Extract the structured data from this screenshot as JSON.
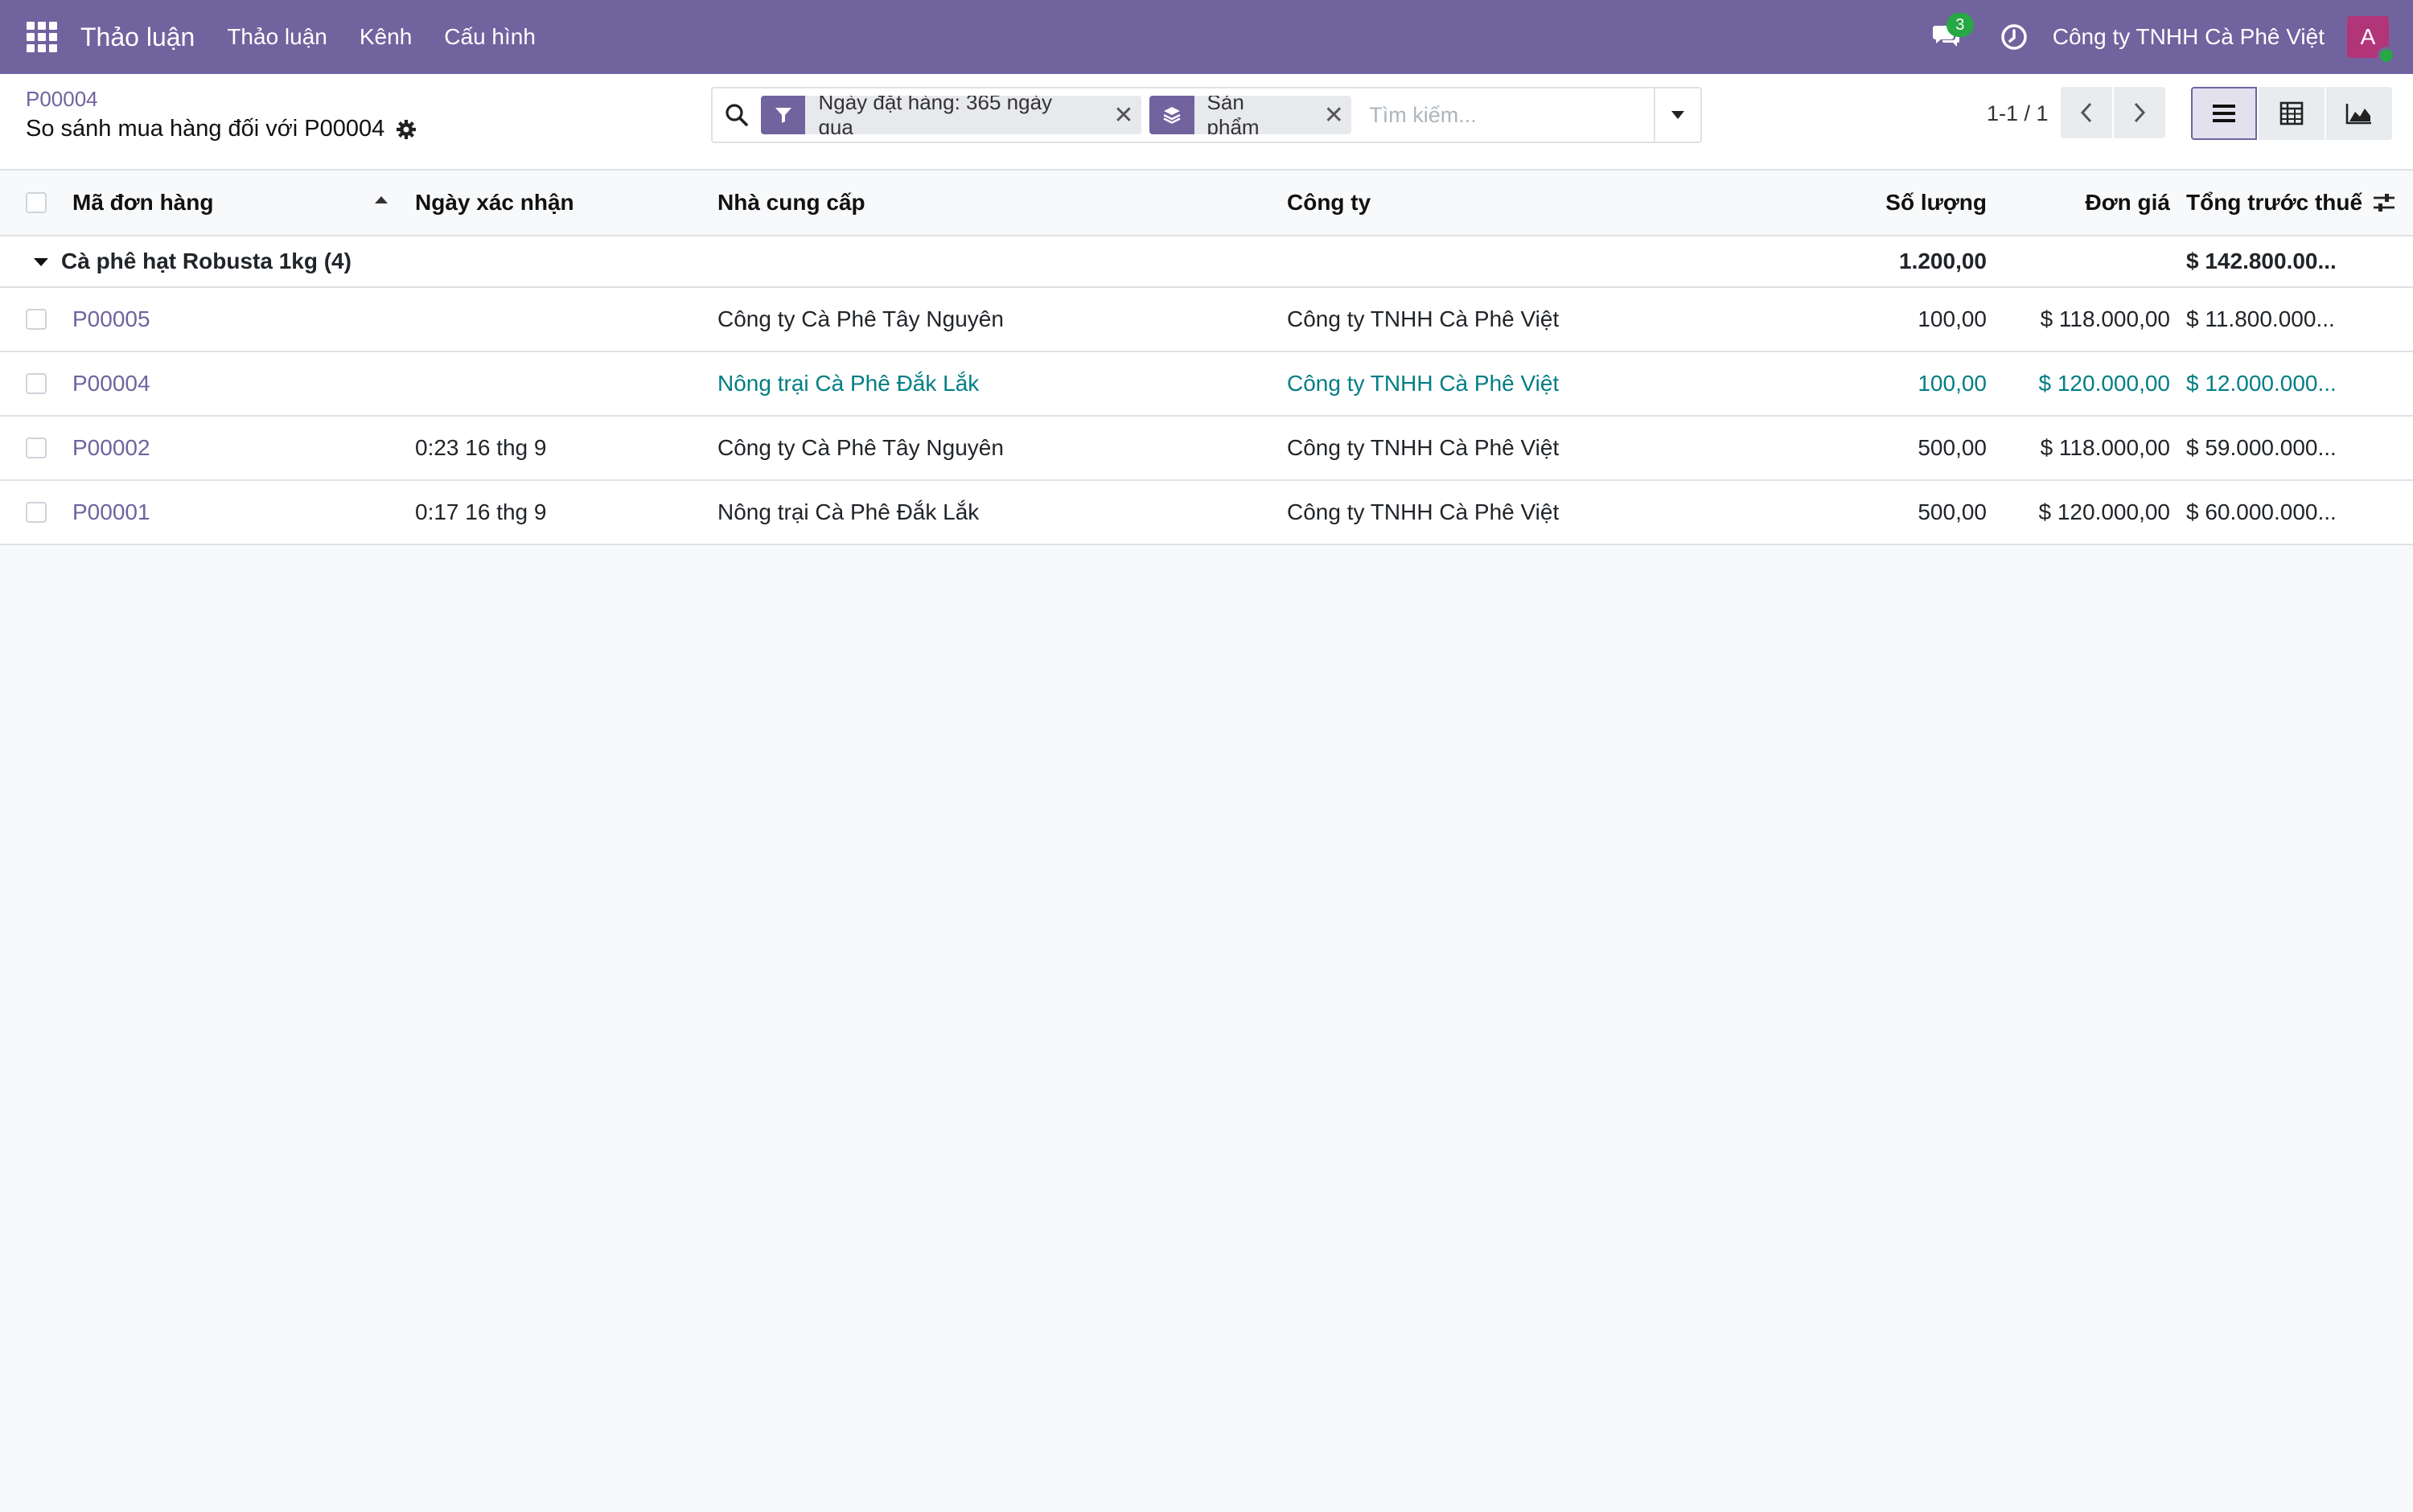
{
  "navbar": {
    "brand": "Thảo luận",
    "menu": [
      "Thảo luận",
      "Kênh",
      "Cấu hình"
    ],
    "chat_count": "3",
    "company": "Công ty TNHH Cà Phê Việt",
    "avatar_initial": "A",
    "bg_color": "#71639e"
  },
  "control": {
    "breadcrumb": "P00004",
    "title": "So sánh mua hàng đối với P00004",
    "facets": [
      {
        "icon": "filter-icon",
        "label": "Ngày đặt hàng: 365 ngày qua"
      },
      {
        "icon": "group-by-icon",
        "label": "Sản phẩm"
      }
    ],
    "search_placeholder": "Tìm kiếm...",
    "pager": "1-1 / 1"
  },
  "table": {
    "columns": [
      "Mã đơn hàng",
      "Ngày xác nhận",
      "Nhà cung cấp",
      "Công ty",
      "Số lượng",
      "Đơn giá",
      "Tổng trước thuế"
    ],
    "group": {
      "label": "Cà phê hạt Robusta 1kg (4)",
      "qty": "1.200,00",
      "total": "$ 142.800.00..."
    },
    "rows": [
      {
        "order": "P00005",
        "date": "",
        "vendor": "Công ty Cà Phê Tây Nguyên",
        "company": "Công ty TNHH Cà Phê Việt",
        "qty": "100,00",
        "price": "$ 118.000,00",
        "total": "$ 11.800.000..."
      },
      {
        "order": "P00004",
        "date": "",
        "vendor": "Nông trại Cà Phê Đắk Lắk",
        "company": "Công ty TNHH Cà Phê Việt",
        "qty": "100,00",
        "price": "$ 120.000,00",
        "total": "$ 12.000.000..."
      },
      {
        "order": "P00002",
        "date": "0:23 16 thg 9",
        "vendor": "Công ty Cà Phê Tây Nguyên",
        "company": "Công ty TNHH Cà Phê Việt",
        "qty": "500,00",
        "price": "$ 118.000,00",
        "total": "$ 59.000.000..."
      },
      {
        "order": "P00001",
        "date": "0:17 16 thg 9",
        "vendor": "Nông trại Cà Phê Đắk Lắk",
        "company": "Công ty TNHH Cà Phê Việt",
        "qty": "500,00",
        "price": "$ 120.000,00",
        "total": "$ 60.000.000..."
      }
    ],
    "highlight_color": "#017e84"
  }
}
